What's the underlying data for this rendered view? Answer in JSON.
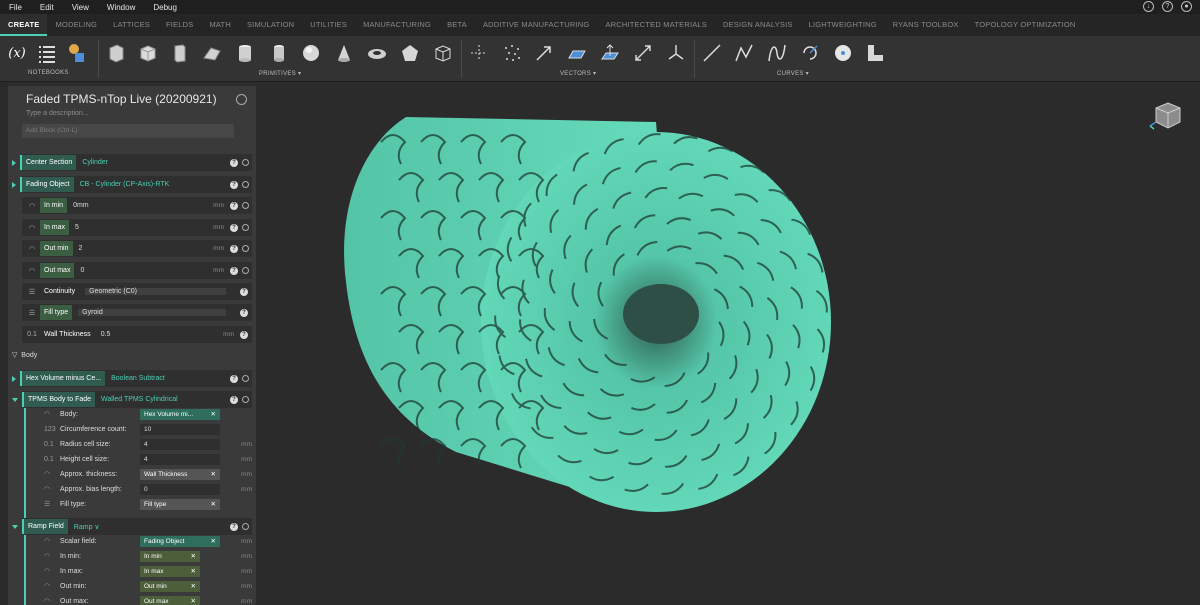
{
  "menu": [
    "File",
    "Edit",
    "View",
    "Window",
    "Debug"
  ],
  "tabs": [
    "CREATE",
    "MODELING",
    "LATTICES",
    "FIELDS",
    "MATH",
    "SIMULATION",
    "UTILITIES",
    "MANUFACTURING",
    "BETA",
    "ADDITIVE MANUFACTURING",
    "ARCHITECTED MATERIALS",
    "DESIGN ANALYSIS",
    "LIGHTWEIGHTING",
    "RYANS TOOLBOX",
    "TOPOLOGY OPTIMIZATION"
  ],
  "ribbon": {
    "notebooks_label": "NOTEBOOKS",
    "primitives_label": "PRIMITIVES",
    "vectors_label": "VECTORS",
    "curves_label": "CURVES",
    "variable_glyph": "(x)"
  },
  "panel": {
    "title": "Faded TPMS-nTop Live (20200921)",
    "description": "Type a description...",
    "add_block": "Add Block   (Ctrl-L)",
    "center_section": {
      "name": "Center Section",
      "type": "Cylinder"
    },
    "fading_object": {
      "name": "Fading Object",
      "type": "CB - Cylinder (CP-Axis)-RTK"
    },
    "in_min": {
      "label": "In min",
      "value": "0mm",
      "unit": "mm"
    },
    "in_max": {
      "label": "In max",
      "value": "5",
      "unit": "mm"
    },
    "out_min": {
      "label": "Out min",
      "value": "2",
      "unit": "mm"
    },
    "out_max": {
      "label": "Out max",
      "value": "0",
      "unit": "mm"
    },
    "continuity": {
      "label": "Continuity",
      "value": "Geometric (C0)"
    },
    "fill_type": {
      "label": "Fill type",
      "value": "Gyroid"
    },
    "wall_thickness": {
      "label": "Wall Thickness",
      "value": "0.5",
      "unit": "mm"
    },
    "body_section": "Body",
    "hex_volume": {
      "name": "Hex Volume minus Ce...",
      "type": "Boolean Subtract"
    },
    "tpms": {
      "name": "TPMS Body to Fade",
      "type": "Walled TPMS Cylindrical",
      "body_label": "Body:",
      "body_value": "Hex Volume mi...",
      "circ_label": "Circumference count:",
      "circ_value": "10",
      "radius_label": "Radius cell size:",
      "radius_value": "4",
      "height_label": "Height cell size:",
      "height_value": "4",
      "thick_label": "Approx. thickness:",
      "thick_value": "Wall Thickness",
      "bias_label": "Approx. bias length:",
      "bias_value": "0",
      "fill_label": "Fill type:",
      "fill_value": "Fill type",
      "mm": "mm"
    },
    "ramp": {
      "name": "Ramp Field",
      "type": "Ramp",
      "scalar_label": "Scalar field:",
      "scalar_value": "Fading Object",
      "inmin_label": "In min:",
      "inmin_value": "In min",
      "inmax_label": "In max:",
      "inmax_value": "In max",
      "outmin_label": "Out min:",
      "outmin_value": "Out min",
      "outmax_label": "Out max:",
      "outmax_value": "Out max",
      "mm": "mm"
    }
  },
  "colors": {
    "accent": "#4bd0b4",
    "model": "#5fd6b6"
  }
}
